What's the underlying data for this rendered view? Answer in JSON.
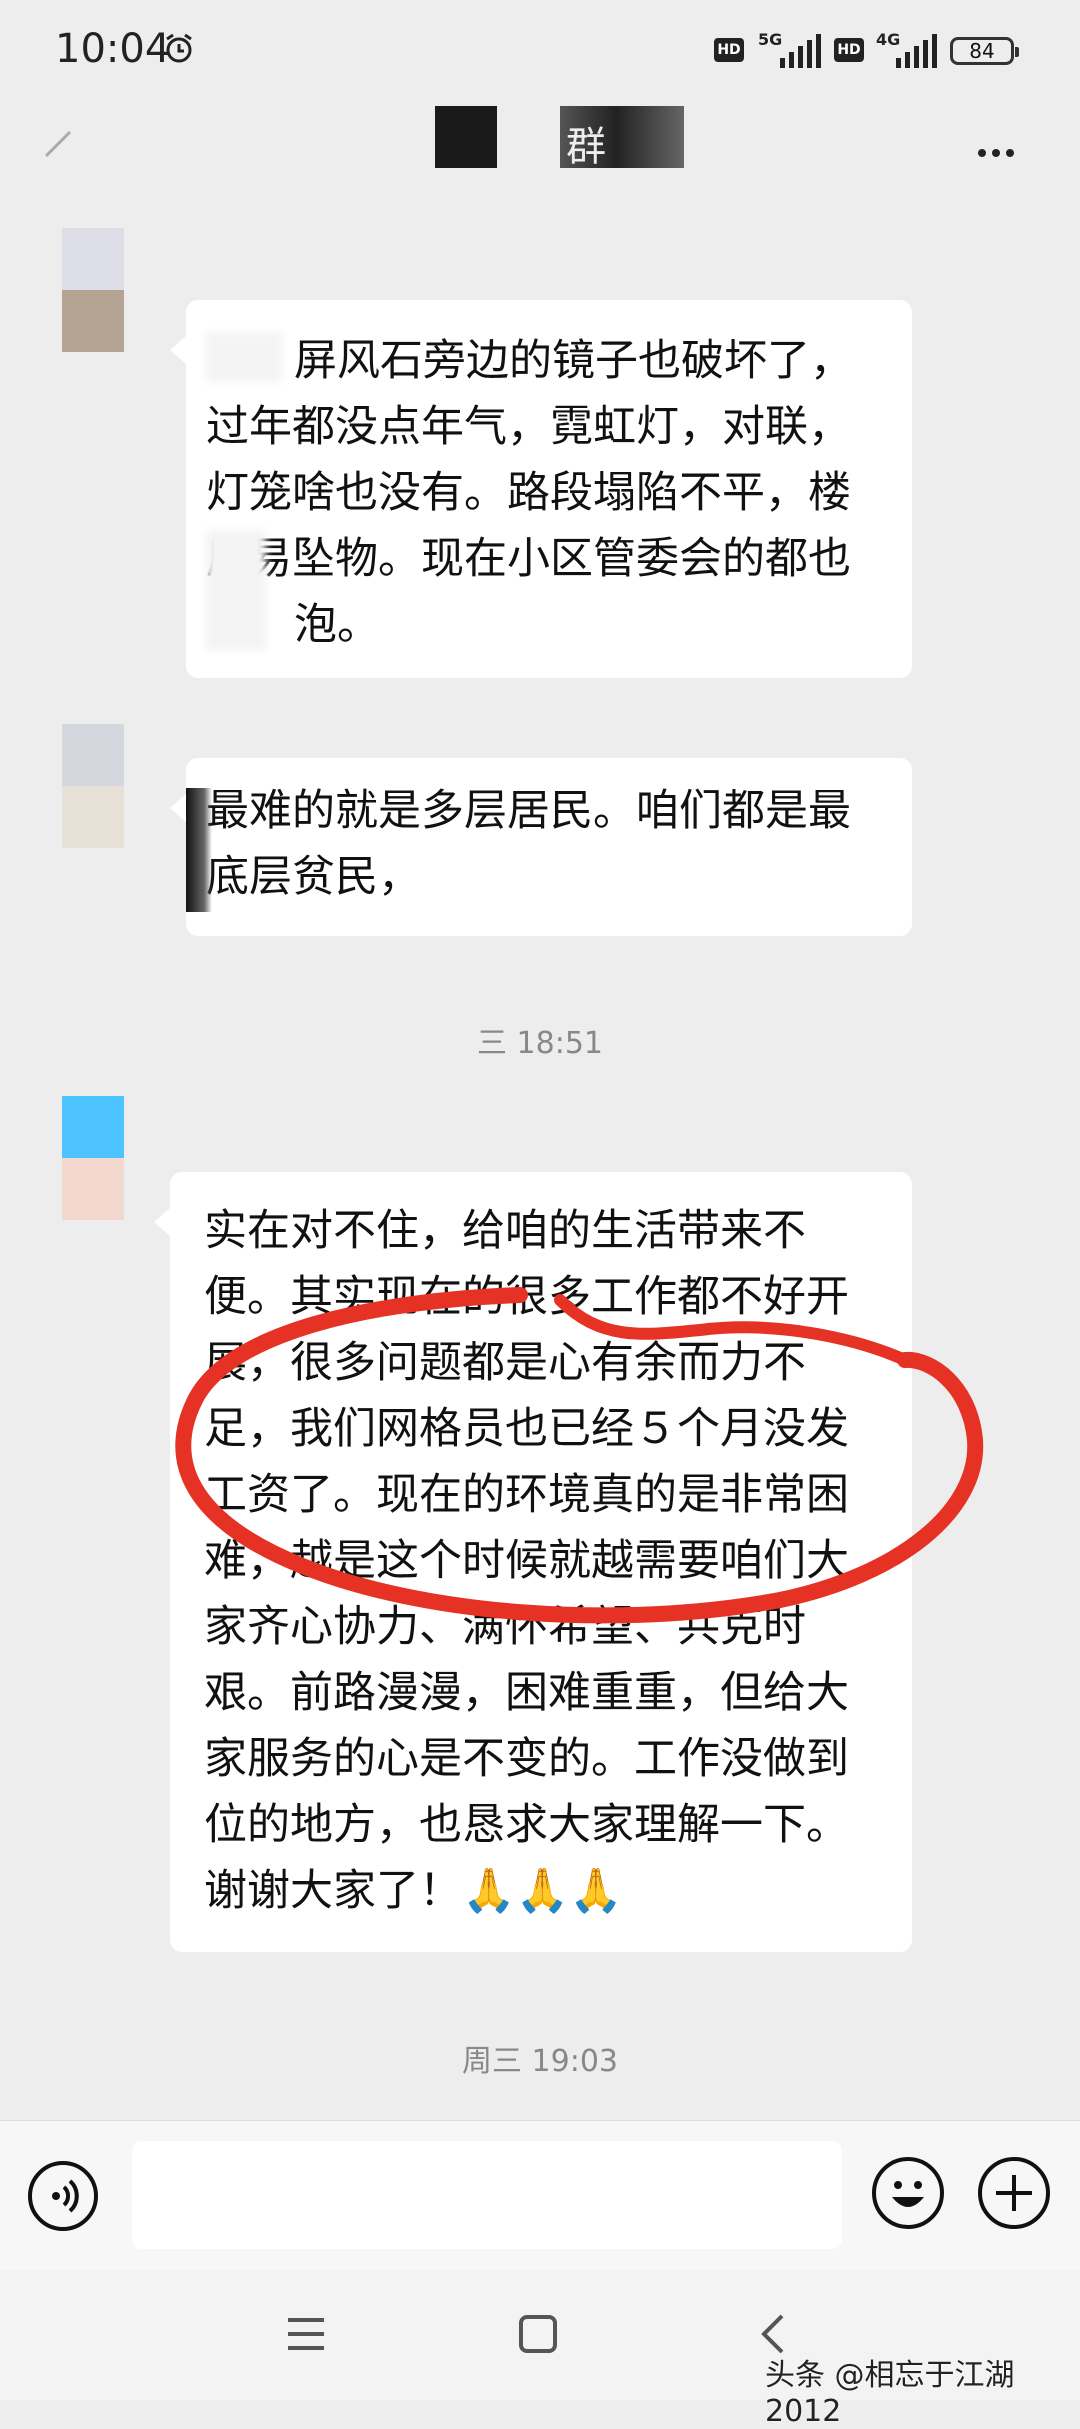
{
  "status_bar": {
    "time": "10:04",
    "net1": "5G",
    "net2": "4G",
    "battery": "84",
    "hd": "HD"
  },
  "header": {
    "title": "群"
  },
  "messages": [
    {
      "lines": [
        "屏风石旁边的镜子也破坏了，",
        "过年都没点年气，霓虹灯，对联，",
        "灯笼啥也没有。路段塌陷不平，楼",
        "房易坠物。现在小区管委会的都也",
        "泡。"
      ]
    },
    {
      "lines": [
        "最难的就是多层居民。咱们都是最",
        "底层贫民，"
      ]
    },
    {
      "lines": [
        "实在对不住，给咱的生活带来不",
        "便。其实现在的很多工作都不好开",
        "展，很多问题都是心有余而力不",
        "足，我们网格员也已经５个月没发",
        "工资了。现在的环境真的是非常困",
        "难，越是这个时候就越需要咱们大",
        "家齐心协力、满怀希望、共克时",
        "艰。前路漫漫，困难重重，但给大",
        "家服务的心是不变的。工作没做到",
        "位的地方，也恳求大家理解一下。",
        "谢谢大家了！🙏🙏🙏"
      ]
    }
  ],
  "timestamps": {
    "first": "三 18:51",
    "second": "周三 19:03"
  },
  "watermark": "头条 @相忘于江湖2012",
  "colors": {
    "background": "#ededed",
    "bubble": "#ffffff",
    "scribble": "#e53224"
  }
}
